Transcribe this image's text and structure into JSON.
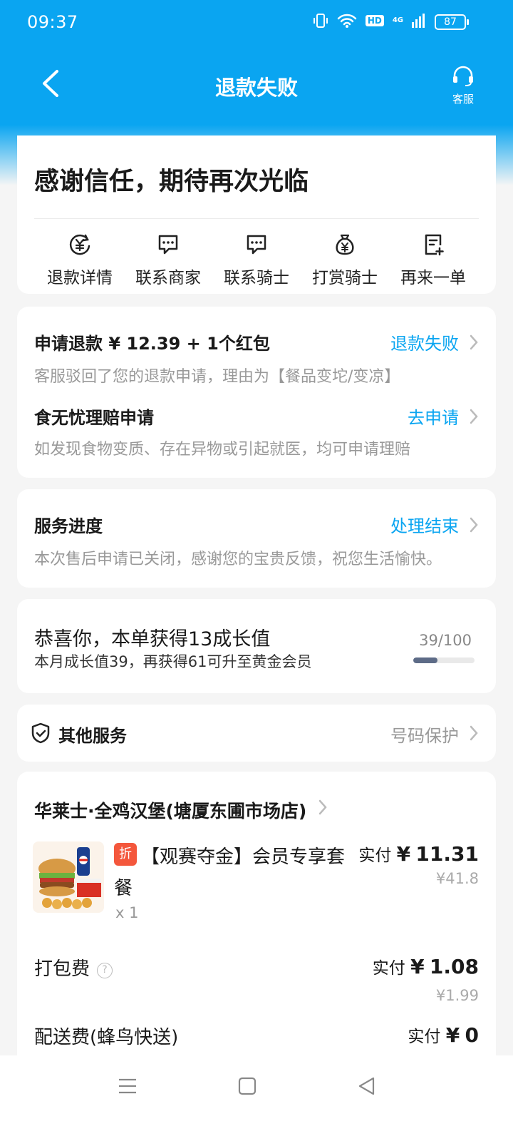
{
  "status_bar": {
    "time": "09:37",
    "network": "4G",
    "hd": "HD",
    "battery": "87"
  },
  "header": {
    "title": "退款失败",
    "service_label": "客服",
    "accent": "#0aa5f1"
  },
  "thanks_card": {
    "message": "感谢信任，期待再次光临",
    "actions": [
      {
        "label": "退款详情",
        "icon": "refund-icon"
      },
      {
        "label": "联系商家",
        "icon": "chat-icon"
      },
      {
        "label": "联系骑士",
        "icon": "chat-icon"
      },
      {
        "label": "打赏骑士",
        "icon": "money-bag-icon"
      },
      {
        "label": "再来一单",
        "icon": "reorder-icon"
      }
    ]
  },
  "refund_card": {
    "apply_title": "申请退款 ¥ 12.39 + 1个红包",
    "apply_status": "退款失败",
    "apply_reason": "客服驳回了您的退款申请，理由为【餐品变坨/变凉】",
    "claim_title": "食无忧理赔申请",
    "claim_link": "去申请",
    "claim_desc": "如发现食物变质、存在异物或引起就医，均可申请理赔"
  },
  "progress_card": {
    "title": "服务进度",
    "status": "处理结束",
    "desc": "本次售后申请已关闭，感谢您的宝贵反馈，祝您生活愉快。"
  },
  "growth_card": {
    "title": "恭喜你，本单获得13成长值",
    "subtitle": "本月成长值39，再获得61可升至黄金会员",
    "count": "39/100",
    "progress_fraction": 0.39
  },
  "other_services": {
    "title": "其他服务",
    "link": "号码保护"
  },
  "order": {
    "shop_name": "华莱士·全鸡汉堡(塘厦东圃市场店)",
    "item": {
      "tag": "折",
      "name": "【观赛夺金】会员专享套餐",
      "qty": "x 1",
      "paid_label": "实付",
      "paid_currency": "¥",
      "paid_amount": "11.31",
      "original": "¥41.8"
    },
    "packing_fee": {
      "label": "打包费",
      "help": "?",
      "paid_label": "实付",
      "currency": "¥",
      "amount": "1.08",
      "original": "¥1.99"
    },
    "delivery_fee": {
      "label": "配送费(蜂鸟快送)",
      "paid_label": "实付",
      "currency": "¥",
      "amount": "0"
    }
  }
}
